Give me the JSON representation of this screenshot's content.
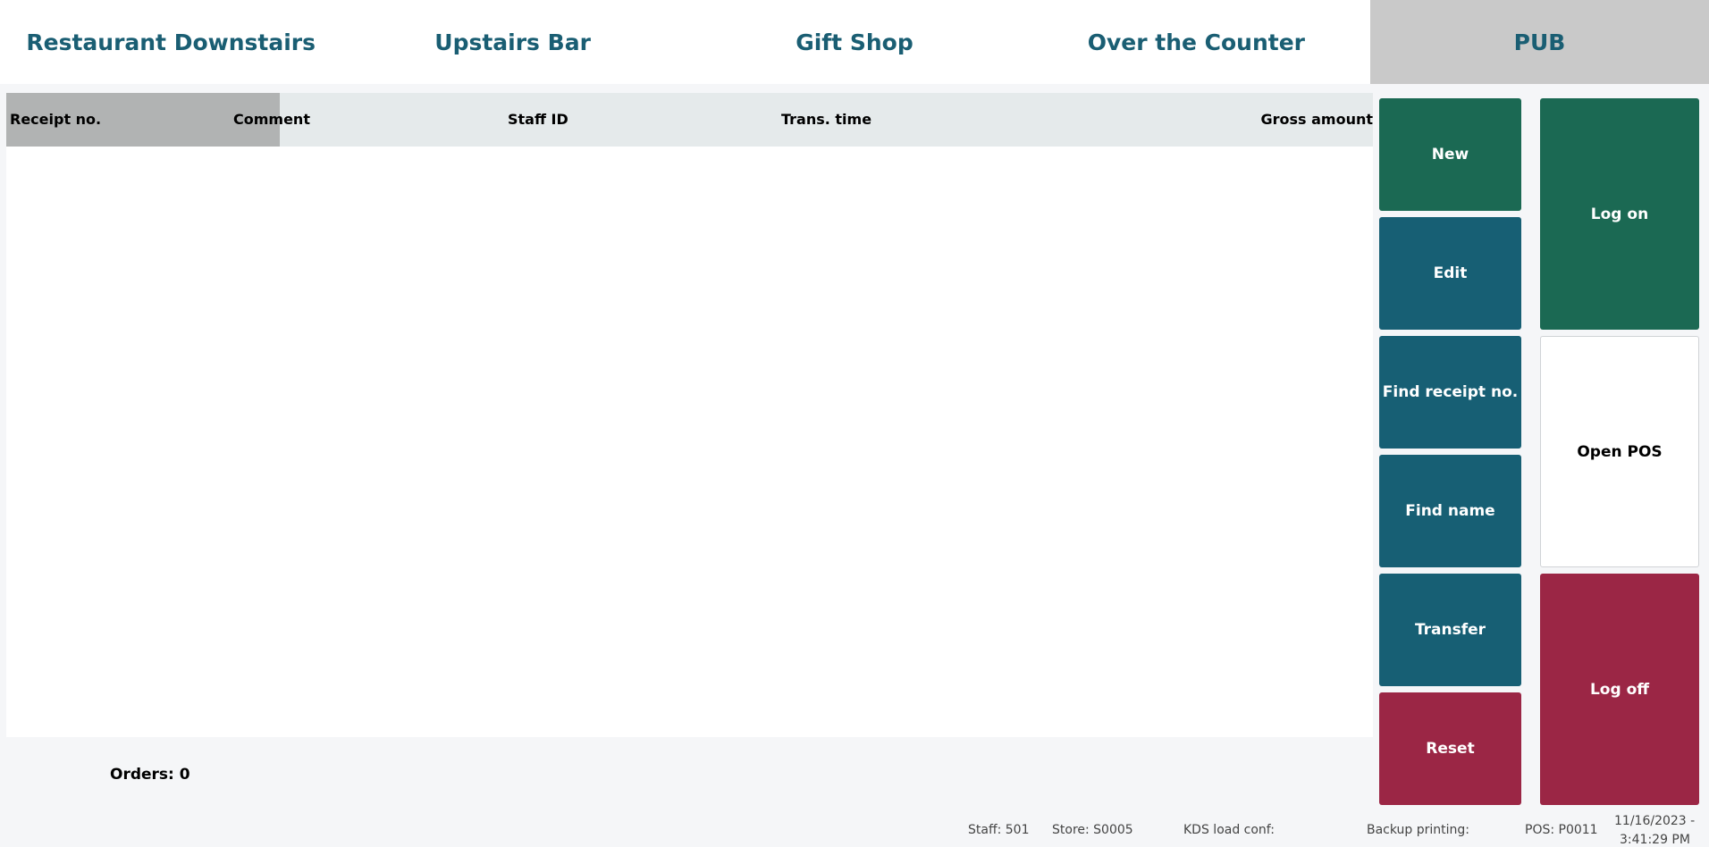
{
  "tabs": [
    "Restaurant Downstairs",
    "Upstairs Bar",
    "Gift Shop",
    "Over the Counter",
    "PUB"
  ],
  "table": {
    "columns": [
      "Receipt no.",
      "Comment",
      "Staff ID",
      "Trans. time",
      "Gross amount"
    ],
    "rows": []
  },
  "buttons": {
    "new": "New",
    "edit": "Edit",
    "find_receipt": "Find receipt no.",
    "find_name": "Find name",
    "transfer": "Transfer",
    "reset": "Reset",
    "log_on": "Log on",
    "open_pos": "Open POS",
    "log_off": "Log off"
  },
  "orders": "Orders: 0",
  "status": {
    "staff": "Staff: 501",
    "store": "Store: S0005",
    "kds": "KDS load conf:",
    "backup": "Backup printing:",
    "pos": "POS: P0011",
    "date": "11/16/2023 -",
    "time": "3:41:29 PM"
  },
  "colors": {
    "green": "#1b6953",
    "teal": "#175f74",
    "red": "#9b2645"
  }
}
